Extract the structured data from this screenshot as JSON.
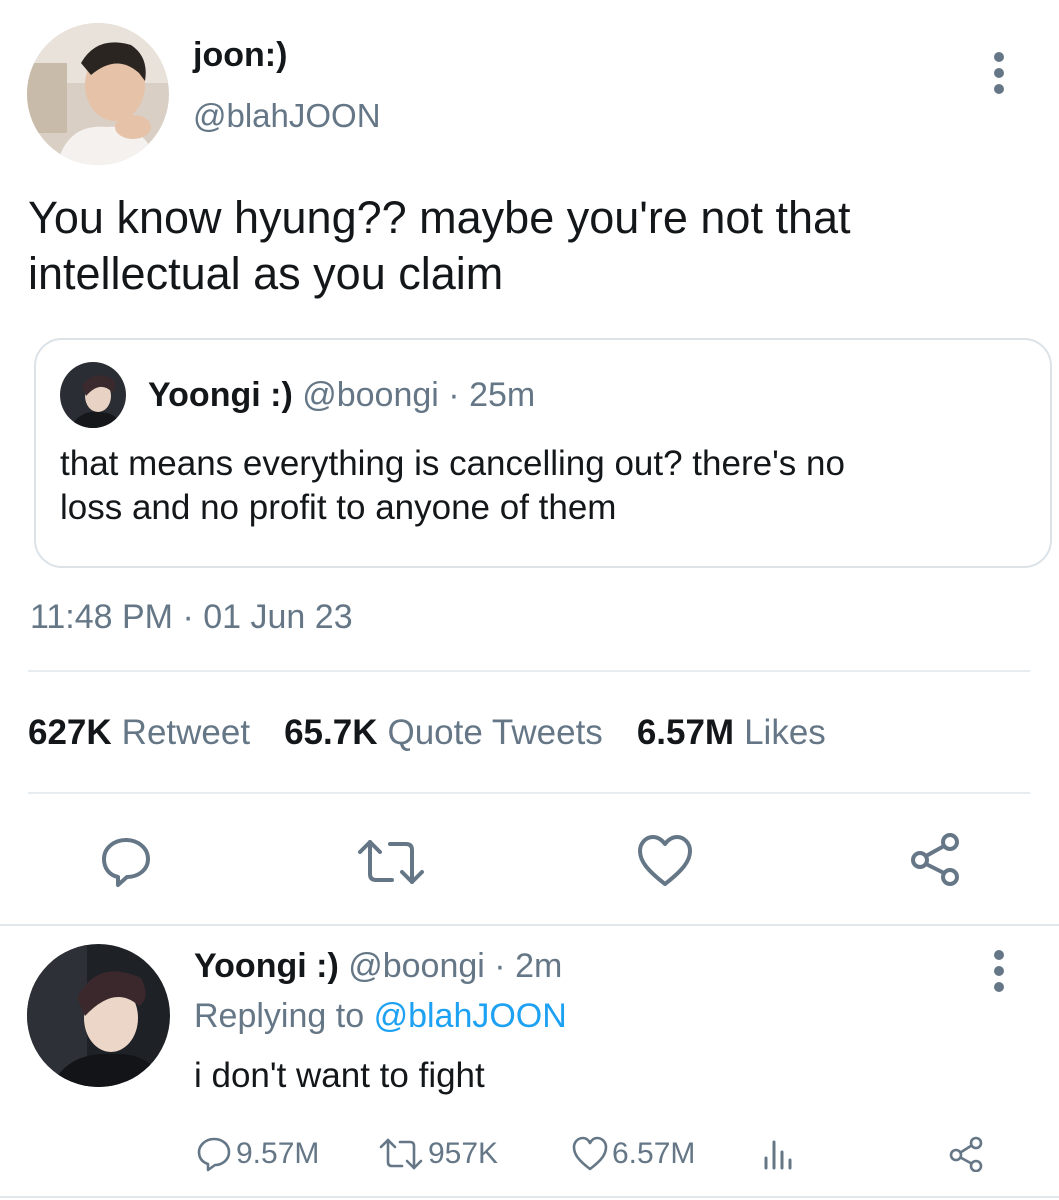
{
  "colors": {
    "text_primary": "#14171a",
    "text_secondary": "#657786",
    "link_blue": "#1da1f2",
    "border": "#e6ecf0"
  },
  "main_tweet": {
    "display_name": "joon:)",
    "handle": "@blahJOON",
    "text_line1": "You know hyung?? maybe you're not that",
    "text_line2": "intellectual as you claim",
    "avatar_icon": "user-avatar-photo",
    "more_icon": "more-vertical-icon"
  },
  "quote": {
    "display_name": "Yoongi :)",
    "handle": "@boongi",
    "separator": "·",
    "time": "25m",
    "text_line1": "that means everything is cancelling out? there's no",
    "text_line2": "loss and no profit to anyone of them"
  },
  "timestamp": {
    "time": "11:48 PM",
    "separator": "·",
    "date": "01 Jun 23"
  },
  "stats": {
    "retweets_count": "627K",
    "retweets_label": "Retweet",
    "quotes_count": "65.7K",
    "quotes_label": "Quote Tweets",
    "likes_count": "6.57M",
    "likes_label": "Likes"
  },
  "actions": {
    "icons": [
      "reply-icon",
      "retweet-icon",
      "like-icon",
      "share-icon"
    ]
  },
  "reply": {
    "display_name": "Yoongi :)",
    "handle": "@boongi",
    "separator": "·",
    "time": "2m",
    "replying_prefix": "Replying to",
    "replying_handle": "@blahJOON",
    "text": "i don't want to fight",
    "reply_count": "9.57M",
    "retweet_count": "957K",
    "like_count": "6.57M"
  }
}
